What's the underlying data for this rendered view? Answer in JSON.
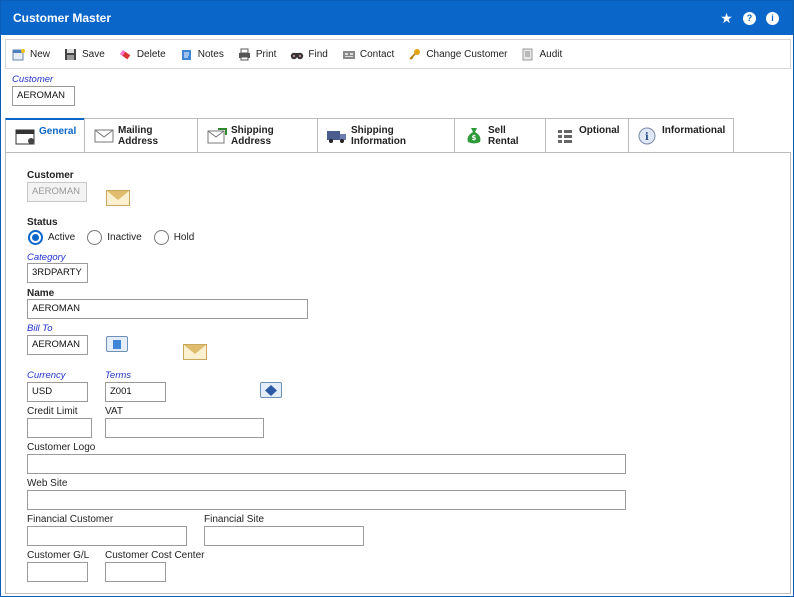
{
  "window": {
    "title": "Customer Master"
  },
  "titlebar_icons": [
    "star-icon",
    "help-icon",
    "info-icon"
  ],
  "toolbar": [
    {
      "label": "New",
      "icon": "new-icon"
    },
    {
      "label": "Save",
      "icon": "save-icon"
    },
    {
      "label": "Delete",
      "icon": "delete-icon"
    },
    {
      "label": "Notes",
      "icon": "notes-icon"
    },
    {
      "label": "Print",
      "icon": "print-icon"
    },
    {
      "label": "Find",
      "icon": "binoculars-icon"
    },
    {
      "label": "Contact",
      "icon": "contact-icon"
    },
    {
      "label": "Change Customer",
      "icon": "key-icon"
    },
    {
      "label": "Audit",
      "icon": "audit-icon"
    }
  ],
  "header": {
    "customer_label": "Customer",
    "customer_value": "AEROMAN"
  },
  "tabs": [
    {
      "label": "General",
      "active": true,
      "icon": "window-icon"
    },
    {
      "label": "Mailing Address",
      "active": false,
      "icon": "envelope-icon"
    },
    {
      "label": "Shipping Address",
      "active": false,
      "icon": "shipping-address-icon"
    },
    {
      "label": "Shipping Information",
      "active": false,
      "icon": "truck-icon"
    },
    {
      "label": "Sell Rental",
      "active": false,
      "icon": "money-bag-icon"
    },
    {
      "label": "Optional",
      "active": false,
      "icon": "grid-icon"
    },
    {
      "label": "Informational",
      "active": false,
      "icon": "info-icon"
    }
  ],
  "general": {
    "customer_label": "Customer",
    "customer_value": "AEROMAN",
    "status_label": "Status",
    "status_options": [
      "Active",
      "Inactive",
      "Hold"
    ],
    "status_selected": "Active",
    "category_label": "Category",
    "category_value": "3RDPARTY",
    "name_label": "Name",
    "name_value": "AEROMAN",
    "bill_to_label": "Bill To",
    "bill_to_value": "AEROMAN",
    "currency_label": "Currency",
    "currency_value": "USD",
    "terms_label": "Terms",
    "terms_value": "Z001",
    "credit_limit_label": "Credit Limit",
    "credit_limit_value": "",
    "vat_label": "VAT",
    "vat_value": "",
    "customer_logo_label": "Customer Logo",
    "customer_logo_value": "",
    "web_site_label": "Web Site",
    "web_site_value": "",
    "financial_customer_label": "Financial Customer",
    "financial_customer_value": "",
    "financial_site_label": "Financial Site",
    "financial_site_value": "",
    "customer_gl_label": "Customer G/L",
    "customer_gl_value": "",
    "customer_cost_center_label": "Customer Cost Center",
    "customer_cost_center_value": ""
  },
  "colors": {
    "titlebar": "#0a66c8",
    "label_blue": "#2233cc",
    "radio_on": "#0a66c8"
  }
}
